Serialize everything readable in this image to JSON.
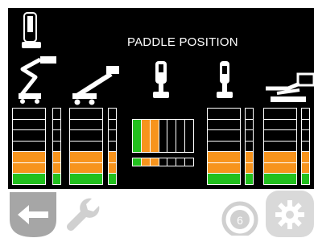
{
  "screen": {
    "title": "PADDLE POSITION"
  },
  "icons": {
    "header": "paddle-joystick-icon",
    "machines": [
      "articulating-boom-lift-icon",
      "telescopic-boom-lift-icon",
      "paddle-front-icon",
      "paddle-side-icon",
      "scissor-lift-icon"
    ]
  },
  "bars": {
    "colors": {
      "green": "#22c01e",
      "orange": "#f7941d",
      "off": "#000000",
      "outline": "#ffffff"
    },
    "vertical": [
      {
        "label": "left-boom-main",
        "lit": [
          "green",
          "orange",
          "orange"
        ]
      },
      {
        "label": "left-boom-side",
        "lit": [
          "green",
          "orange",
          "orange"
        ]
      },
      {
        "label": "boom2-main",
        "lit": [
          "green",
          "orange",
          "orange"
        ]
      },
      {
        "label": "boom2-side",
        "lit": [
          "green",
          "orange",
          "orange"
        ]
      },
      {
        "label": "right1-main",
        "lit": [
          "green",
          "orange",
          "orange"
        ]
      },
      {
        "label": "right1-side",
        "lit": [
          "green",
          "orange",
          "orange"
        ]
      },
      {
        "label": "right2-main",
        "lit": [
          "green",
          "orange",
          "orange"
        ]
      },
      {
        "label": "right2-side",
        "lit": [
          "green",
          "orange",
          "orange"
        ]
      }
    ],
    "horizontal_lit": [
      "green",
      "orange",
      "orange"
    ]
  },
  "toolbar": {
    "buttons": [
      "back-arrow-icon",
      "wrench-icon",
      "unlock-icon",
      "gear-icon"
    ]
  }
}
